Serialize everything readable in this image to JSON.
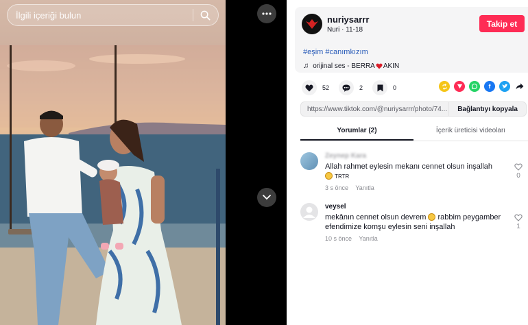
{
  "search": {
    "placeholder": "İlgili içeriği bulun"
  },
  "post": {
    "username": "nuriysarrr",
    "display_name": "Nuri",
    "date": "11-18",
    "follow_label": "Takip et",
    "hashtags": "#eşim #canımkızım",
    "sound": "orijinal ses - BERRA",
    "sound_suffix": "AKIN",
    "likes": "52",
    "comments": "2",
    "saves": "0",
    "link_url": "https://www.tiktok.com/@nuriysarrr/photo/74...",
    "copy_label": "Bağlantıyı kopyala"
  },
  "tabs": [
    {
      "label": "Yorumlar (2)",
      "active": true
    },
    {
      "label": "İçerik üreticisi videoları",
      "active": false
    }
  ],
  "comments": [
    {
      "name": "Zeynep Kara",
      "text": "Allah rahmet eylesin mekanı cennet olsun inşallah",
      "extra": "TRTR",
      "time": "3 s önce",
      "reply_label": "Yanıtla",
      "likes": "0"
    },
    {
      "name": "veysel",
      "text_before_emoji": "mekânın cennet olsun devrem",
      "text_after_emoji": "rabbim peygamber efendimize komşu eylesin seni inşallah",
      "time": "10 s önce",
      "reply_label": "Yanıtla",
      "likes": "1"
    }
  ],
  "colors": {
    "accent": "#fe2c55",
    "hashtag": "#2b5db9",
    "text_primary": "#161823",
    "text_secondary": "#8a8b91"
  },
  "share_icons": [
    "repost-icon",
    "tiktok-share-icon",
    "whatsapp-icon",
    "facebook-icon",
    "twitter-icon",
    "share-arrow-icon"
  ]
}
